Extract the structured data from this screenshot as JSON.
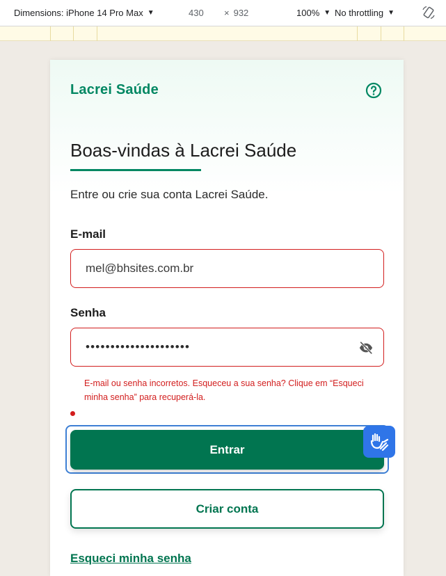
{
  "devtools": {
    "device_label": "Dimensions: iPhone 14 Pro Max",
    "caret": "▼",
    "width": "430",
    "times": "×",
    "height": "932",
    "zoom": "100%",
    "throttling": "No throttling"
  },
  "header": {
    "brand": "Lacrei Saúde",
    "help_icon": "question-circle-icon"
  },
  "main": {
    "title": "Boas-vindas à Lacrei Saúde",
    "subtitle": "Entre ou crie sua conta Lacrei Saúde."
  },
  "form": {
    "email_label": "E-mail",
    "email_value": "mel@bhsites.com.br",
    "password_label": "Senha",
    "password_value": "•••••••••••••••••••••",
    "eye_icon": "eye-slash-icon",
    "error_message": "E-mail ou senha incorretos. Esqueceu a sua senha? Clique em “Esqueci minha senha” para recuperá-la.",
    "submit_label": "Entrar",
    "create_label": "Criar conta",
    "forgot_label": "Esqueci minha senha"
  },
  "widgets": {
    "accessibility_icon": "sign-language-hands-icon"
  },
  "colors": {
    "brand_green": "#018762",
    "button_green": "#017550",
    "error_red": "#d21d1d",
    "focus_blue": "#3d7fd4",
    "widget_blue": "#2f75e8"
  }
}
